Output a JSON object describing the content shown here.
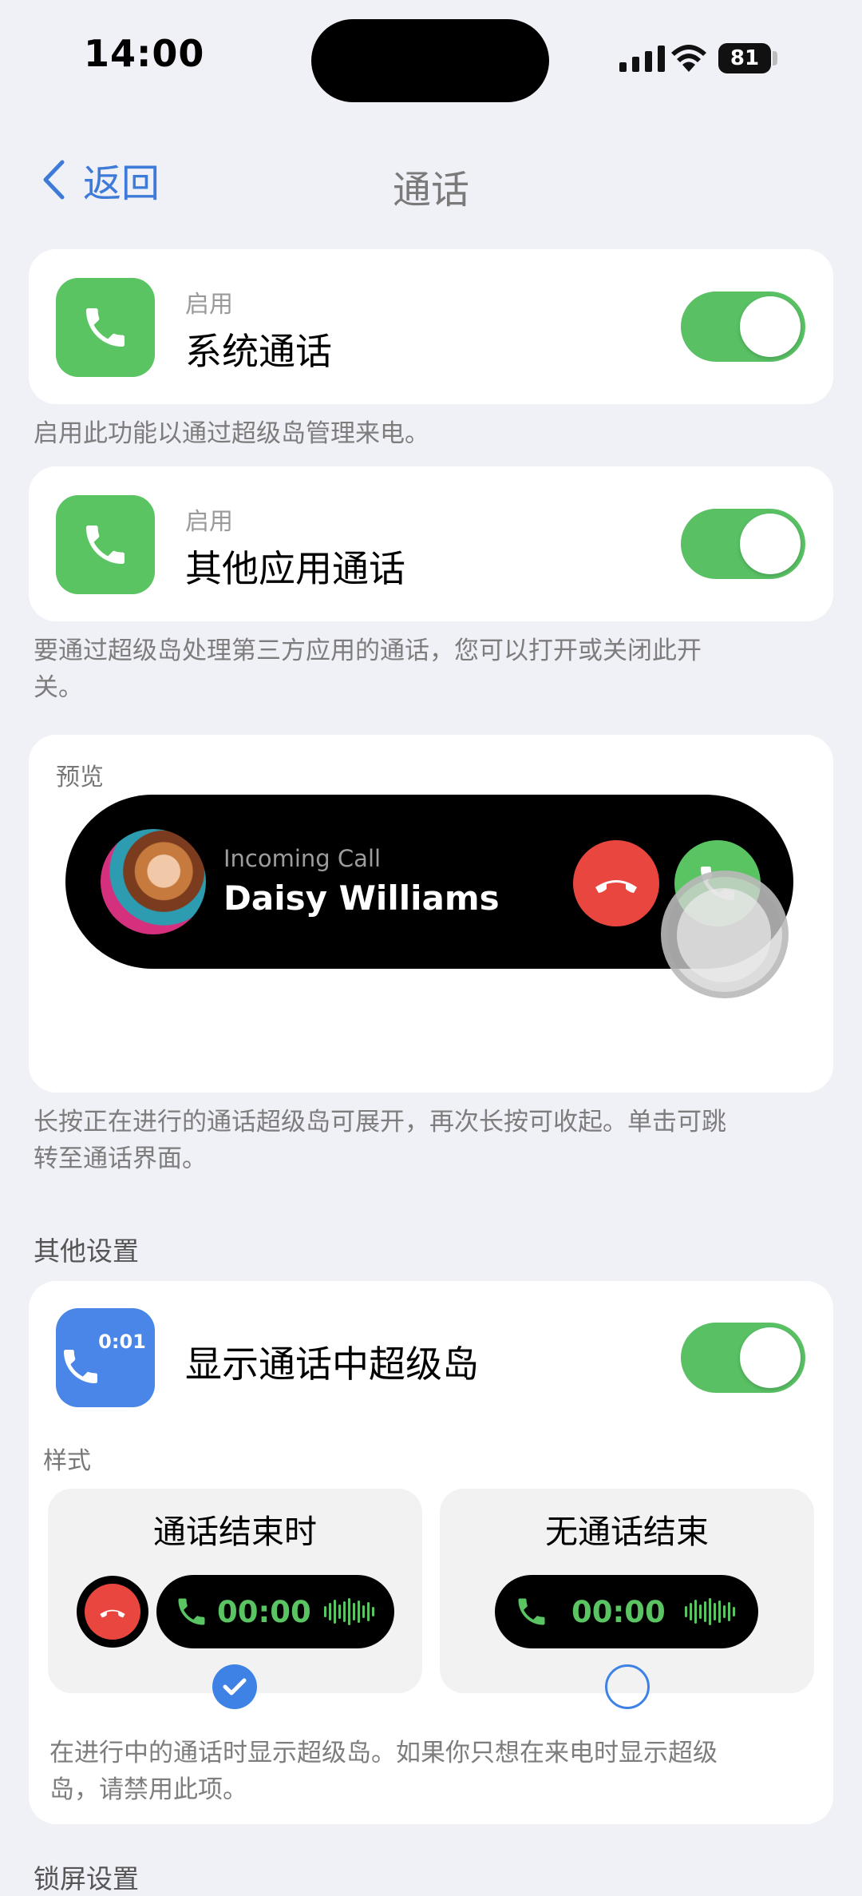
{
  "status_bar": {
    "time": "14:00",
    "battery": "81"
  },
  "nav": {
    "back_label": "返回",
    "title": "通话"
  },
  "system_call": {
    "enabled_label": "启用",
    "title": "系统通话",
    "toggle_on": true,
    "description": "启用此功能以通过超级岛管理来电。"
  },
  "other_app_call": {
    "enabled_label": "启用",
    "title": "其他应用通话",
    "toggle_on": true,
    "description_line1": "要通过超级岛处理第三方应用的通话，您可以打开或关闭此开",
    "description_line2": "关。"
  },
  "preview": {
    "label": "预览",
    "incoming_label": "Incoming Call",
    "caller_name": "Daisy Williams",
    "description_line1": "长按正在进行的通话超级岛可展开，再次长按可收起。单击可跳",
    "description_line2": "转至通话界面。"
  },
  "other_settings": {
    "section_title": "其他设置",
    "show_island_label": "显示通话中超级岛",
    "icon_time": "0:01",
    "toggle_on": true,
    "style_label": "样式",
    "options": [
      {
        "title": "通话结束时",
        "time": "00:00",
        "selected": true
      },
      {
        "title": "无通话结束",
        "time": "00:00",
        "selected": false
      }
    ],
    "description_line1": "在进行中的通话时显示超级岛。如果你只想在来电时显示超级",
    "description_line2": "岛，请禁用此项。"
  },
  "next_section_title": "锁屏设置",
  "colors": {
    "accent": "#3E7BD8",
    "green": "#5AC463",
    "red": "#E9463F",
    "background": "#F0F0F7"
  }
}
